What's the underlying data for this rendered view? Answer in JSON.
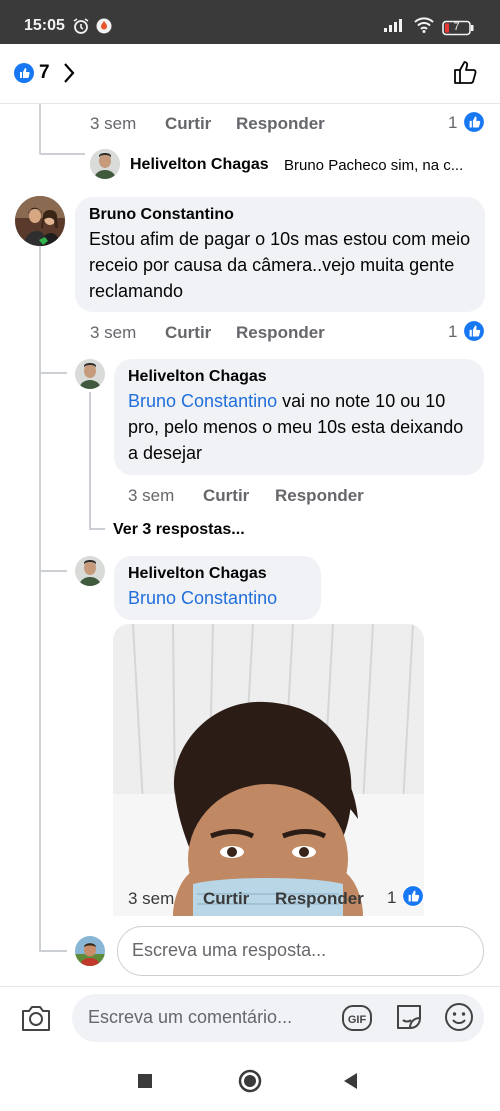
{
  "status": {
    "time": "15:05",
    "battery": "7"
  },
  "reactions": {
    "count": "7"
  },
  "comments": {
    "c0": {
      "time": "3 sem",
      "like": "Curtir",
      "reply": "Responder",
      "reactions": "1"
    },
    "c0_reply_preview": {
      "name": "Helivelton Chagas",
      "snippet": "Bruno Pacheco sim, na c..."
    },
    "c1": {
      "name": "Bruno Constantino",
      "text": "Estou afim de pagar o 10s mas estou com meio receio por causa da câmera..vejo muita gente reclamando",
      "time": "3 sem",
      "like": "Curtir",
      "reply": "Responder",
      "reactions": "1"
    },
    "r1": {
      "name": "Helivelton Chagas",
      "mention": "Bruno Constantino",
      "text": " vai no note 10 ou 10 pro, pelo menos o meu 10s esta deixando a desejar",
      "time": "3 sem",
      "like": "Curtir",
      "reply": "Responder"
    },
    "more_replies": "Ver 3 respostas...",
    "r2": {
      "name": "Helivelton Chagas",
      "mention": "Bruno Constantino",
      "time": "3 sem",
      "like": "Curtir",
      "reply": "Responder",
      "reactions": "1"
    }
  },
  "inputs": {
    "reply_placeholder": "Escreva uma resposta...",
    "comment_placeholder": "Escreva um comentário..."
  },
  "colors": {
    "accent": "#1877f2",
    "mention": "#216fdb"
  }
}
